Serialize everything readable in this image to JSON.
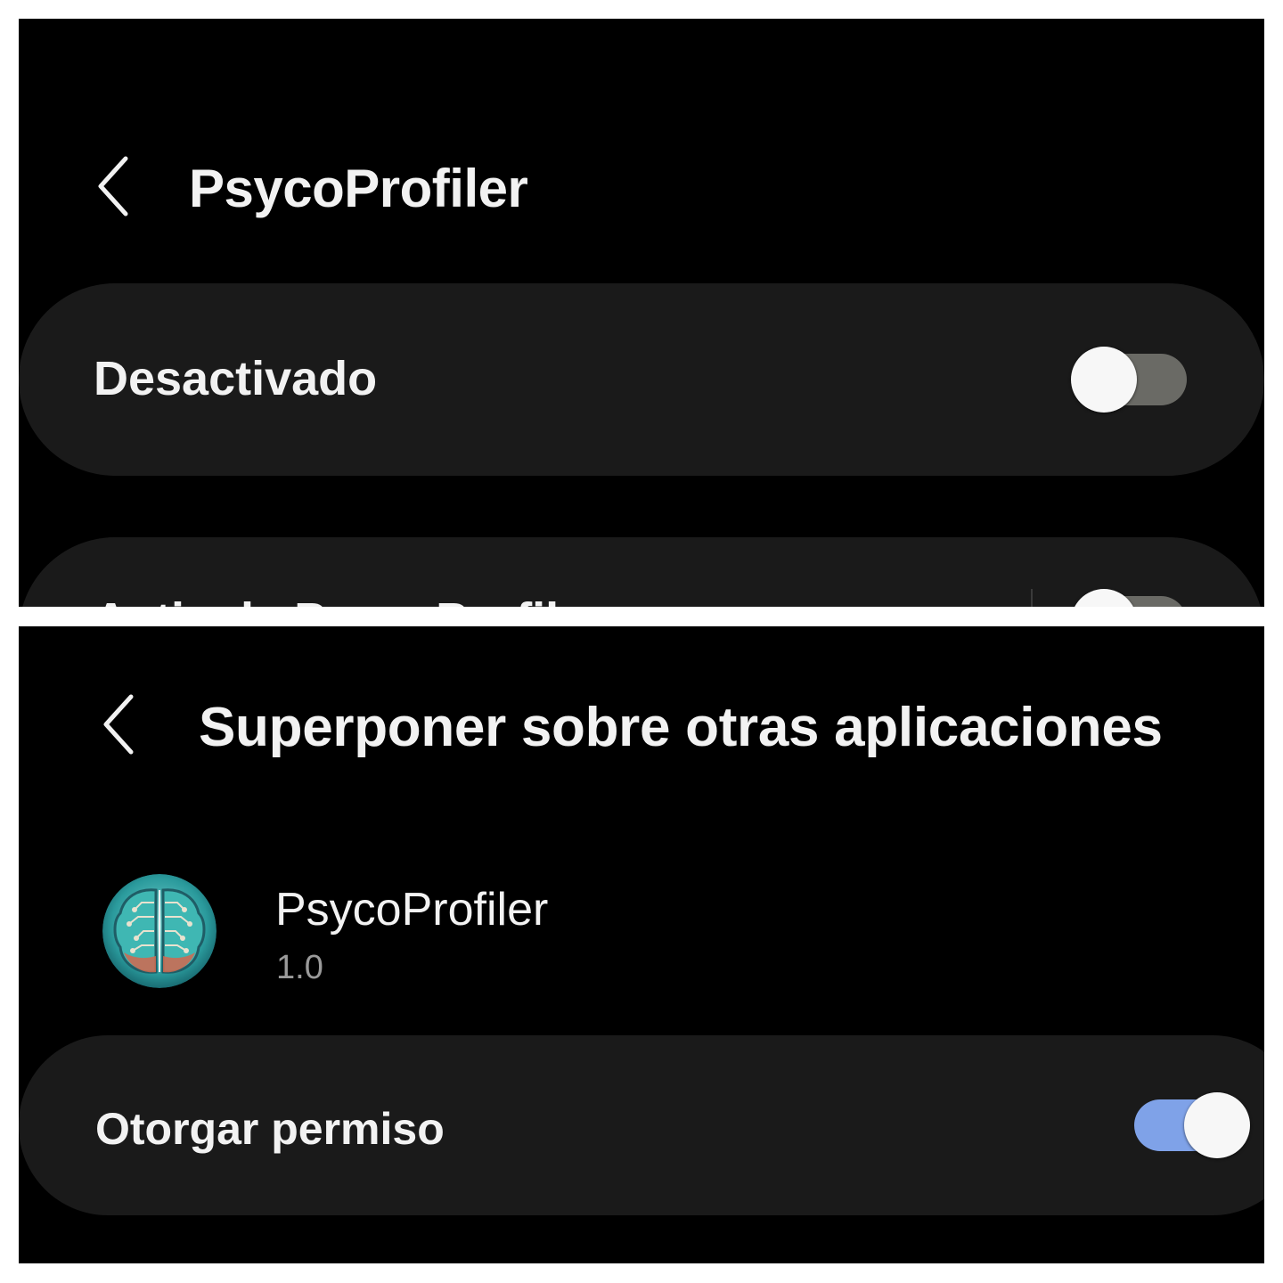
{
  "top_screen": {
    "title": "PsycoProfiler",
    "main_switch": {
      "label": "Desactivado",
      "state": "off"
    },
    "second_row": {
      "label_partial": "Activ de PsycoProfiler",
      "state": "off"
    }
  },
  "bottom_screen": {
    "title": "Superponer sobre otras aplicaciones",
    "app": {
      "name": "PsycoProfiler",
      "version": "1.0",
      "icon": "brain-icon"
    },
    "permission": {
      "label": "Otorgar permiso",
      "state": "on"
    }
  },
  "colors": {
    "background": "#000000",
    "card": "#1a1a1a",
    "text": "#f2f2f2",
    "secondary_text": "#9a9a9a",
    "toggle_off_track": "#6a6a65",
    "toggle_on_track": "#7fa2e8",
    "knob": "#f7f7f7"
  }
}
